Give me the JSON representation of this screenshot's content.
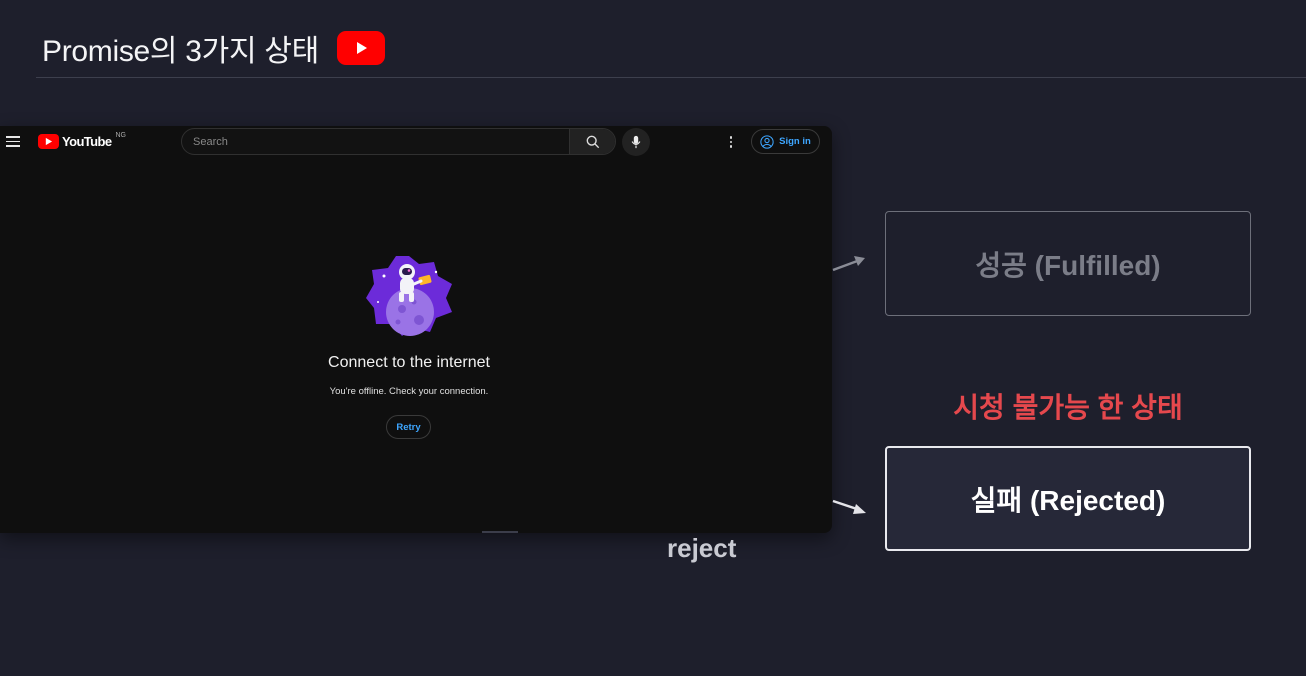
{
  "slide": {
    "title": "Promise의 3가지 상태"
  },
  "youtube": {
    "brand": "YouTube",
    "country_code": "NG",
    "search_placeholder": "Search",
    "signin_label": "Sign in",
    "offline_title": "Connect to the internet",
    "offline_message": "You're offline. Check your connection.",
    "retry_label": "Retry"
  },
  "diagram": {
    "fulfilled_label": "성공 (Fulfilled)",
    "unavailable_label": "시청 불가능 한 상태",
    "rejected_label": "실패 (Rejected)",
    "reject_edge_label": "reject"
  },
  "colors": {
    "background": "#1e1f2c",
    "youtube_red": "#ff0000",
    "unavailable_text": "#e5484d",
    "link_blue": "#3ea6ff"
  }
}
